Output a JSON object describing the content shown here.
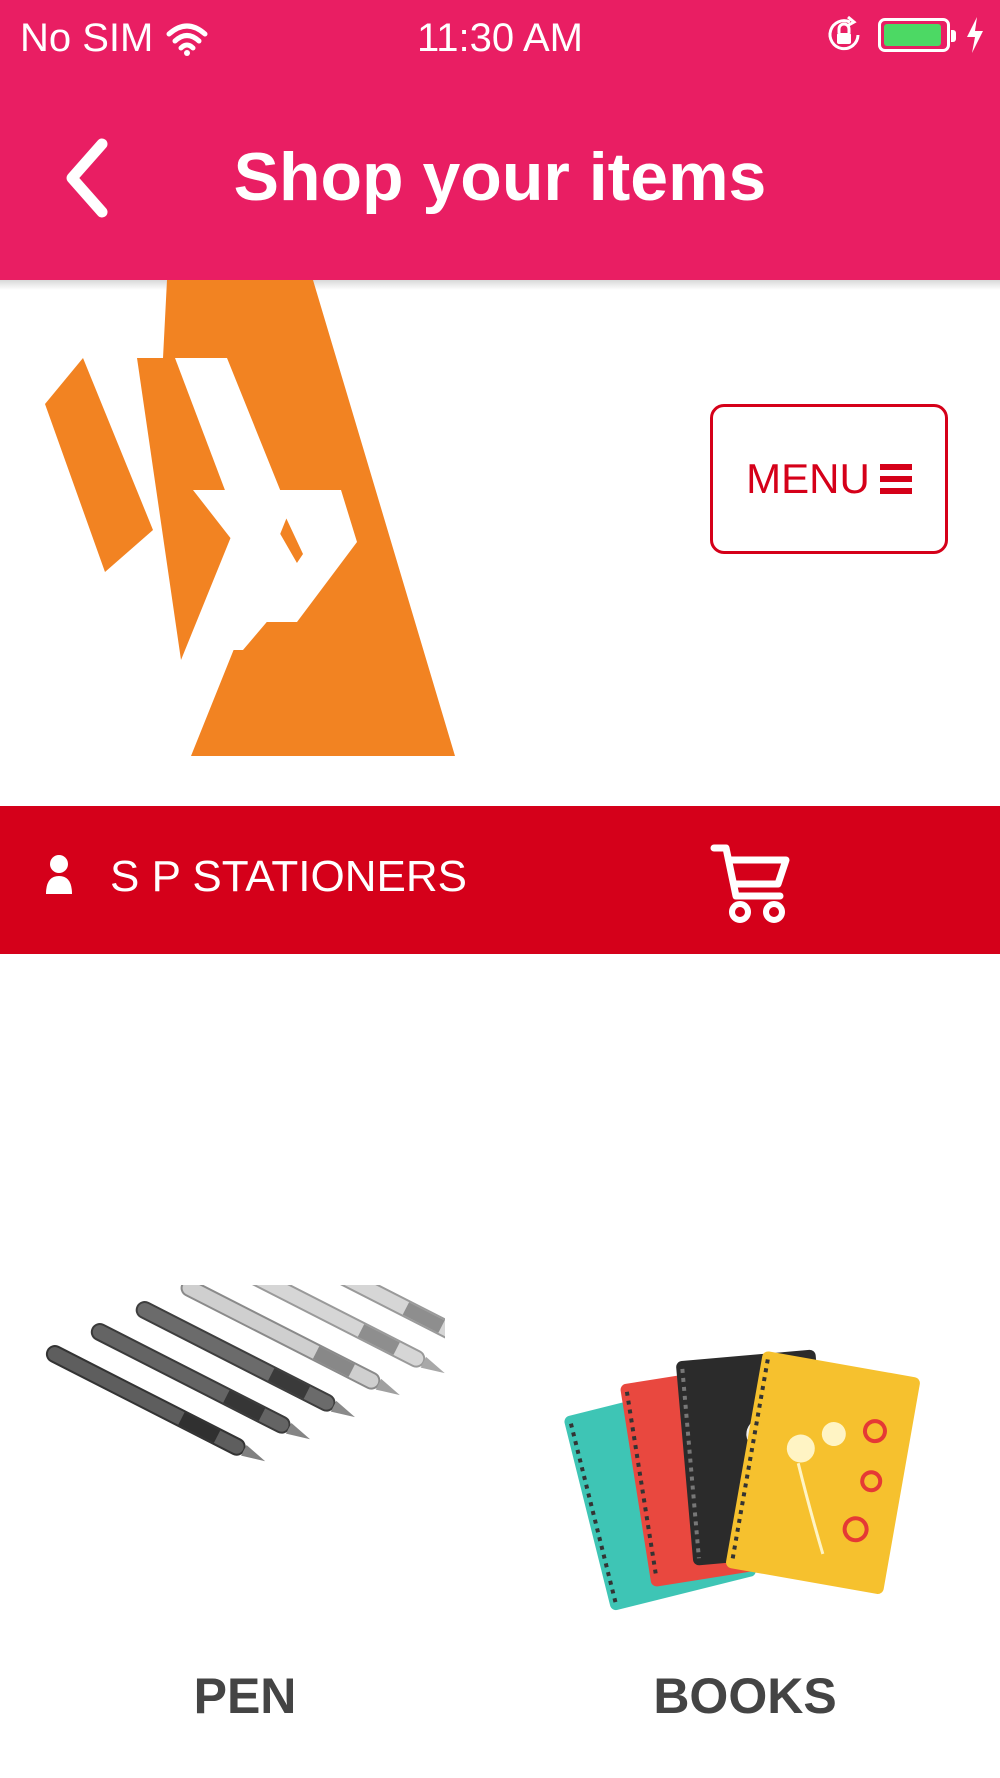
{
  "status_bar": {
    "carrier": "No SIM",
    "time": "11:30 AM",
    "battery_level": 0.95
  },
  "nav": {
    "title": "Shop your items",
    "back_icon": "chevron-left-icon"
  },
  "header": {
    "menu_label": "MENU",
    "menu_icon": "hamburger-icon",
    "logo_color": "#F28322"
  },
  "store_bar": {
    "name": "S P STATIONERS",
    "user_icon": "user-icon",
    "cart_icon": "cart-icon"
  },
  "products": [
    {
      "label": "PEN",
      "icon": "pen-image"
    },
    {
      "label": "BOOKS",
      "icon": "notebooks-image"
    }
  ],
  "colors": {
    "nav_background": "#E91E63",
    "store_bar_background": "#D5001A",
    "accent_red": "#D50019",
    "battery_green": "#4CD964",
    "label_text": "#444444"
  }
}
